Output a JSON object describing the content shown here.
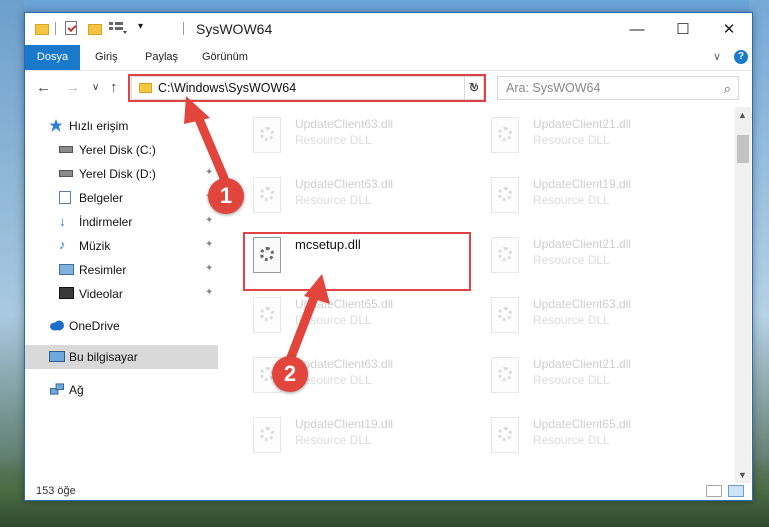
{
  "window": {
    "title": "SysWOW64",
    "controls": {
      "minimize": "—",
      "maximize": "☐",
      "close": "✕"
    }
  },
  "ribbon": {
    "tabs": [
      "Dosya",
      "Giriş",
      "Paylaş",
      "Görünüm"
    ],
    "collapse_glyph": "∨",
    "help_glyph": "?"
  },
  "navigation": {
    "back_glyph": "←",
    "forward_glyph": "→",
    "recent_glyph": "∨",
    "up_glyph": "↑",
    "address": "C:\\Windows\\SysWOW64",
    "address_dropdown_glyph": "∨",
    "refresh_glyph": "↻",
    "search_placeholder": "Ara: SysWOW64",
    "search_glyph": "⌕"
  },
  "sidebar": {
    "items": [
      {
        "label": "Hızlı erişim",
        "icon": "star-icon",
        "pinned": false
      },
      {
        "label": "Yerel Disk (C:)",
        "icon": "drive-icon",
        "pinned": true
      },
      {
        "label": "Yerel Disk (D:)",
        "icon": "drive-icon",
        "pinned": true
      },
      {
        "label": "Belgeler",
        "icon": "documents-icon",
        "pinned": true
      },
      {
        "label": "İndirmeler",
        "icon": "download-icon",
        "pinned": true
      },
      {
        "label": "Müzik",
        "icon": "music-icon",
        "pinned": true
      },
      {
        "label": "Resimler",
        "icon": "pictures-icon",
        "pinned": true
      },
      {
        "label": "Videolar",
        "icon": "videos-icon",
        "pinned": true
      },
      {
        "label": "OneDrive",
        "icon": "cloud-icon",
        "pinned": false
      },
      {
        "label": "Bu bilgisayar",
        "icon": "computer-icon",
        "pinned": false,
        "selected": true
      },
      {
        "label": "Ağ",
        "icon": "network-icon",
        "pinned": false
      }
    ],
    "pin_glyph": "📌"
  },
  "files": {
    "left_column": [
      {
        "name": "UpdateClient63.dll",
        "desc": "Resource DLL"
      },
      {
        "name": "UpdateClient63.dll",
        "desc": "Resource DLL"
      },
      {
        "name": "mcsetup.dll",
        "desc": "",
        "highlighted": true
      },
      {
        "name": "UpdateClient65.dll",
        "desc": "Resource DLL"
      },
      {
        "name": "UpdateClient63.dll",
        "desc": "Resource DLL"
      },
      {
        "name": "UpdateClient19.dll",
        "desc": "Resource DLL"
      }
    ],
    "right_column": [
      {
        "name": "UpdateClient21.dll",
        "desc": "Resource DLL"
      },
      {
        "name": "UpdateClient19.dll",
        "desc": "Resource DLL"
      },
      {
        "name": "UpdateClient21.dll",
        "desc": "Resource DLL"
      },
      {
        "name": "UpdateClient63.dll",
        "desc": "Resource DLL"
      },
      {
        "name": "UpdateClient21.dll",
        "desc": "Resource DLL"
      },
      {
        "name": "UpdateClient65.dll",
        "desc": "Resource DLL"
      }
    ]
  },
  "status": {
    "item_count": "153 öğe"
  },
  "annotations": {
    "step1": "1",
    "step2": "2",
    "color": "#e2453b"
  }
}
